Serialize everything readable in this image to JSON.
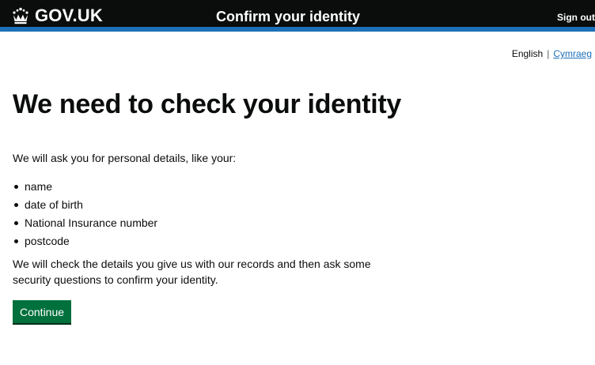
{
  "header": {
    "brand": "GOV.UK",
    "brand_icon": "crown-icon",
    "service_name": "Confirm your identity",
    "sign_out": "Sign out",
    "accent_color": "#1d70b8",
    "background_color": "#0b0c0c"
  },
  "language": {
    "current": "English",
    "separator": "|",
    "other": "Cymraeg"
  },
  "main": {
    "title": "We need to check your identity",
    "intro": "We will ask you for personal details, like your:",
    "details": [
      "name",
      "date of birth",
      "National Insurance number",
      "postcode"
    ],
    "body": "We will check the details you give us with our records and then ask some security questions to confirm your identity.",
    "continue_label": "Continue",
    "button_color": "#00703c"
  }
}
